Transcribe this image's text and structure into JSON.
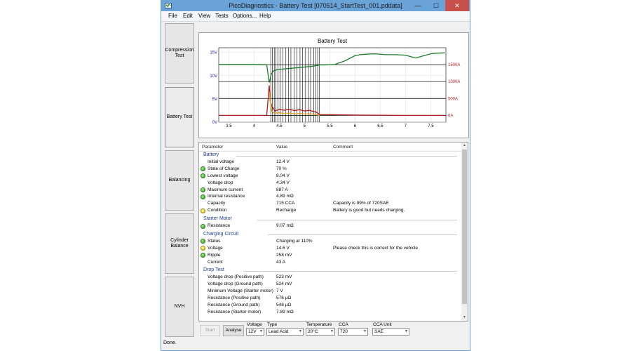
{
  "window": {
    "title": "PicoDiagnostics - Battery Test [070514_StartTest_001.pddata]",
    "minimize_icon": "—",
    "maximize_icon": "☐",
    "close_icon": "✕"
  },
  "menu": [
    "File",
    "Edit",
    "View",
    "Tests",
    "Options...",
    "Help"
  ],
  "tests": [
    {
      "label": "Compression Test"
    },
    {
      "label": "Battery Test"
    },
    {
      "label": "Balancing"
    },
    {
      "label": "Cylinder Balance"
    },
    {
      "label": "NVH"
    }
  ],
  "chart_data": {
    "type": "line",
    "title": "Battery Test",
    "xlim": [
      3.3,
      7.8
    ],
    "x_ticks": [
      3.5,
      4,
      4.5,
      5,
      5.5,
      6,
      6.5,
      7,
      7.5
    ],
    "y_left": {
      "label": "",
      "range": [
        0,
        16
      ],
      "ticks": [
        {
          "v": 0,
          "t": "0V"
        },
        {
          "v": 5,
          "t": "5V"
        },
        {
          "v": 10,
          "t": "10V"
        },
        {
          "v": 15,
          "t": "15V"
        }
      ],
      "color": "#2020c0"
    },
    "y_right": {
      "label": "",
      "range": [
        -200,
        2000
      ],
      "ticks": [
        {
          "v": 0,
          "t": "0A"
        },
        {
          "v": 500,
          "t": "500A"
        },
        {
          "v": 1000,
          "t": "1000A"
        },
        {
          "v": 1500,
          "t": "1500A"
        }
      ],
      "color": "#c02020"
    },
    "grid": true,
    "series": [
      {
        "axis": "left",
        "color": "#1c7a2a",
        "x": [
          3.3,
          4.0,
          4.25,
          4.3,
          4.34,
          4.38,
          4.45,
          4.55,
          4.65,
          4.75,
          4.85,
          4.95,
          5.05,
          5.15,
          5.25,
          5.3,
          5.4,
          5.6,
          5.8,
          6.0,
          6.1,
          6.2,
          6.4,
          6.6,
          6.8,
          7.0,
          7.2,
          7.4,
          7.5,
          7.6,
          7.78
        ],
        "y": [
          12.4,
          12.4,
          12.35,
          8.5,
          10.3,
          11.0,
          11.3,
          11.4,
          11.5,
          11.6,
          11.7,
          11.8,
          11.9,
          12.0,
          12.2,
          12.3,
          12.3,
          12.4,
          13.2,
          14.3,
          14.5,
          14.6,
          14.7,
          14.5,
          14.5,
          14.4,
          13.8,
          14.4,
          14.7,
          14.8,
          14.9
        ]
      },
      {
        "axis": "right",
        "color": "#b01818",
        "x": [
          3.3,
          4.25,
          4.3,
          4.32,
          4.36,
          4.42,
          4.5,
          4.6,
          4.7,
          4.8,
          4.9,
          5.0,
          5.1,
          5.2,
          5.25,
          5.3,
          5.5,
          6.0,
          6.5,
          7.0,
          7.5,
          7.78
        ],
        "y": [
          0,
          0,
          887,
          420,
          250,
          130,
          180,
          150,
          180,
          140,
          170,
          130,
          150,
          110,
          80,
          20,
          20,
          10,
          5,
          0,
          0,
          0
        ]
      },
      {
        "axis": "right",
        "color": "#e0a020",
        "x": [
          4.3,
          4.35,
          4.4,
          4.5,
          4.6,
          4.7,
          4.8,
          4.9,
          5.0,
          5.1,
          5.2,
          5.3
        ],
        "y": [
          700,
          120,
          60,
          80,
          50,
          70,
          40,
          60,
          40,
          50,
          30,
          0
        ]
      }
    ],
    "markers_x": [
      4.33,
      4.36,
      4.4,
      4.43,
      4.47,
      4.52,
      4.57,
      4.63,
      4.68,
      4.73,
      4.79,
      4.85,
      4.91,
      4.96,
      5.02,
      5.08,
      5.12,
      5.18,
      5.22,
      5.26,
      5.29
    ]
  },
  "table": {
    "headers": {
      "parameter": "Parameter",
      "value": "Value",
      "comment": "Comment"
    },
    "sections": [
      {
        "title": "Battery",
        "rows": [
          {
            "name": "Initial voltage",
            "value": "12.4 V",
            "comment": "",
            "status": ""
          },
          {
            "name": "State of Charge",
            "value": "70 %",
            "comment": "",
            "status": "green"
          },
          {
            "name": "Lowest voltage",
            "value": "8.04 V",
            "comment": "",
            "status": "green"
          },
          {
            "name": "Voltage drop",
            "value": "4.34 V",
            "comment": "",
            "status": ""
          },
          {
            "name": "Maximum current",
            "value": "887 A",
            "comment": "",
            "status": "green"
          },
          {
            "name": "Internal resistance",
            "value": "4.89 mΩ",
            "comment": "",
            "status": "green"
          },
          {
            "name": "Capacity",
            "value": "715 CCA",
            "comment": "Capacity is 99% of 720SAE",
            "status": ""
          },
          {
            "name": "Condition",
            "value": "Recharge",
            "comment": "Battery is good but needs charging.",
            "status": "yellow"
          }
        ]
      },
      {
        "title": "Starter Motor",
        "rows": [
          {
            "name": "Resistance",
            "value": "9.07 mΩ",
            "comment": "",
            "status": "green"
          }
        ]
      },
      {
        "title": "Charging Circuit",
        "rows": [
          {
            "name": "Status",
            "value": "Charging at 110%",
            "comment": "",
            "status": "green"
          },
          {
            "name": "Voltage",
            "value": "14.6 V",
            "comment": "Please check this is correct for the vehicle",
            "status": "yellow"
          },
          {
            "name": "Ripple",
            "value": "258 mV",
            "comment": "",
            "status": "green"
          },
          {
            "name": "Current",
            "value": "43 A",
            "comment": "",
            "status": ""
          }
        ]
      },
      {
        "title": "Drop Test",
        "rows": [
          {
            "name": "Voltage drop (Positive path)",
            "value": "523 mV",
            "comment": "",
            "status": ""
          },
          {
            "name": "Voltage drop (Ground path)",
            "value": "524 mV",
            "comment": "",
            "status": ""
          },
          {
            "name": "Minimum Voltage (Starter motor)",
            "value": "7 V",
            "comment": "",
            "status": ""
          },
          {
            "name": "Resistance (Positive path)",
            "value": "576 µΩ",
            "comment": "",
            "status": ""
          },
          {
            "name": "Resistance (Ground path)",
            "value": "548 µΩ",
            "comment": "",
            "status": ""
          },
          {
            "name": "Resistance (Starter motor)",
            "value": "7.89 mΩ",
            "comment": "",
            "status": ""
          }
        ]
      }
    ]
  },
  "controls": {
    "start_label": "Start",
    "analyse_label": "Analyse",
    "voltage": {
      "label": "Voltage",
      "value": "12V"
    },
    "type": {
      "label": "Type",
      "value": "Lead Acid"
    },
    "temperature": {
      "label": "Temperature",
      "value": "20°C"
    },
    "cca": {
      "label": "CCA",
      "value": "720"
    },
    "cca_unit": {
      "label": "CCA Unit",
      "value": "SAE"
    }
  },
  "status": {
    "text": "Done."
  }
}
